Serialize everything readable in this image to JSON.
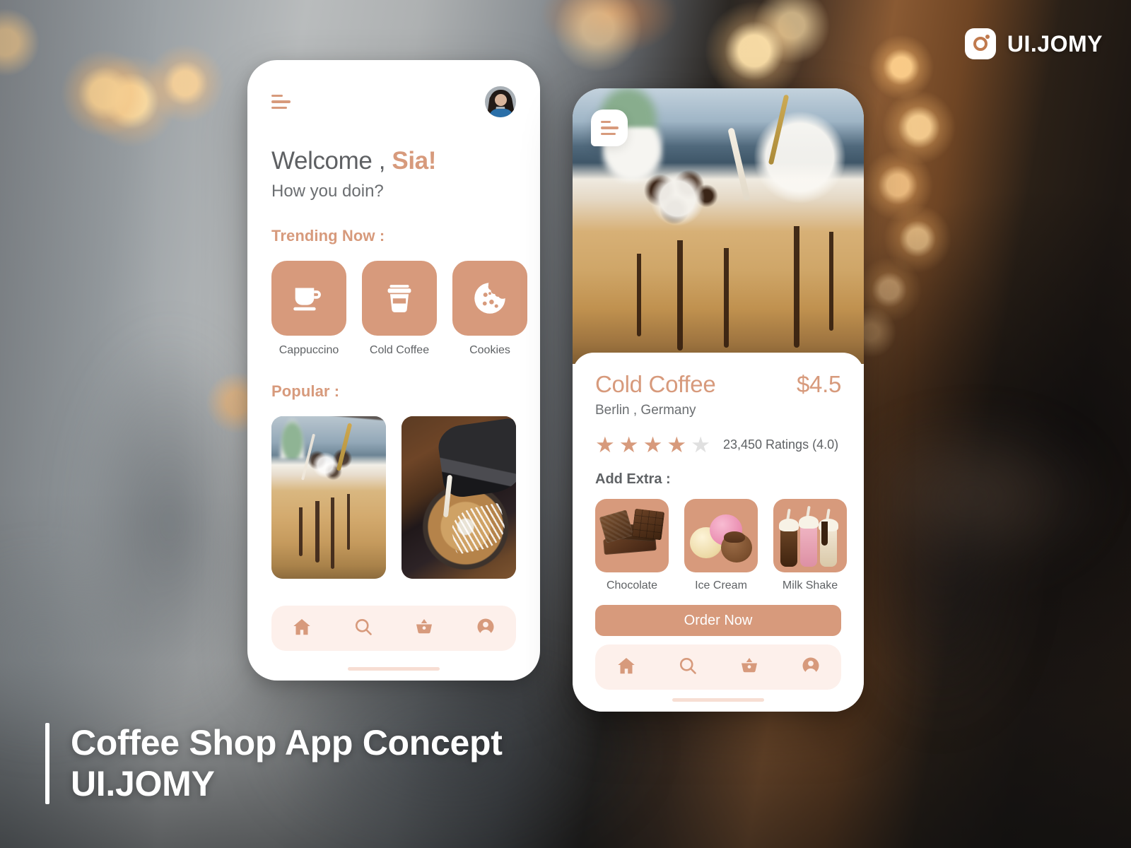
{
  "watermark": {
    "handle": "UI.JOMY",
    "icon": "instagram-icon"
  },
  "caption": {
    "title": "Coffee Shop App Concept",
    "subtitle": "UI.JOMY"
  },
  "colors": {
    "accent": "#d79a7c",
    "nav_background": "#fdf0eb",
    "card_background": "#ffffff",
    "body_text": "#5f6265",
    "star_off": "#e0e0e0"
  },
  "home_screen": {
    "menu_icon": "hamburger-menu-icon",
    "avatar": "user-avatar",
    "greeting_prefix": "Welcome , ",
    "greeting_name": "Sia!",
    "greeting_sub": "How you doin?",
    "trending_title": "Trending Now :",
    "trending": [
      {
        "label": "Cappuccino",
        "icon": "coffee-cup-icon"
      },
      {
        "label": "Cold Coffee",
        "icon": "takeaway-cup-icon"
      },
      {
        "label": "Cookies",
        "icon": "cookie-icon"
      }
    ],
    "popular_title": "Popular :",
    "popular": [
      {
        "name": "iced-coffee-photo"
      },
      {
        "name": "latte-art-photo"
      }
    ],
    "nav": [
      {
        "label": "Home",
        "icon": "home-icon"
      },
      {
        "label": "Search",
        "icon": "search-icon"
      },
      {
        "label": "Cart",
        "icon": "basket-icon"
      },
      {
        "label": "Profile",
        "icon": "person-icon"
      }
    ]
  },
  "detail_screen": {
    "menu_icon": "hamburger-menu-icon",
    "hero": "cold-coffee-photo",
    "title": "Cold Coffee",
    "price": "$4.5",
    "location": "Berlin , Germany",
    "rating_value": 4,
    "rating_max": 5,
    "rating_text": "23,450 Ratings (4.0)",
    "extras_title": "Add Extra :",
    "extras": [
      {
        "label": "Chocolate",
        "icon": "chocolate-icon"
      },
      {
        "label": "Ice Cream",
        "icon": "ice-cream-icon"
      },
      {
        "label": "Milk Shake",
        "icon": "milkshake-icon"
      }
    ],
    "order_label": "Order Now",
    "nav": [
      {
        "label": "Home",
        "icon": "home-icon"
      },
      {
        "label": "Search",
        "icon": "search-icon"
      },
      {
        "label": "Cart",
        "icon": "basket-icon"
      },
      {
        "label": "Profile",
        "icon": "person-icon"
      }
    ]
  }
}
